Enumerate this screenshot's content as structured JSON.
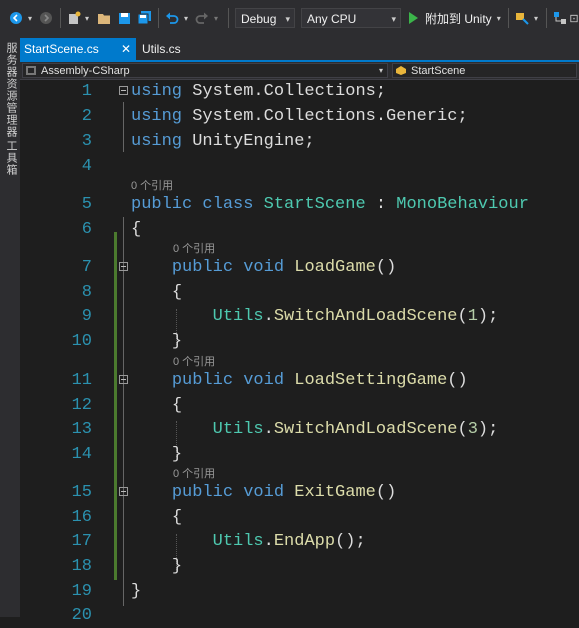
{
  "toolbar": {
    "config_value": "Debug",
    "platform_value": "Any CPU",
    "attach_label": "附加到 Unity"
  },
  "side_tabs": [
    "服务器资源管理器",
    "工具箱"
  ],
  "tabs": [
    {
      "label": "StartScene.cs",
      "active": true,
      "close": "✕"
    },
    {
      "label": "Utils.cs",
      "active": false
    }
  ],
  "nav": {
    "project": "Assembly-CSharp",
    "class": "StartScene"
  },
  "lines": [
    {
      "n": "1"
    },
    {
      "n": "2"
    },
    {
      "n": "3"
    },
    {
      "n": "4"
    },
    {
      "n": "5"
    },
    {
      "n": "6"
    },
    {
      "n": "7"
    },
    {
      "n": "8"
    },
    {
      "n": "9"
    },
    {
      "n": "10"
    },
    {
      "n": "11"
    },
    {
      "n": "12"
    },
    {
      "n": "13"
    },
    {
      "n": "14"
    },
    {
      "n": "15"
    },
    {
      "n": "16"
    },
    {
      "n": "17"
    },
    {
      "n": "18"
    },
    {
      "n": "19"
    },
    {
      "n": "20"
    }
  ],
  "code": {
    "kw_using": "using",
    "ns1": " System.Collections;",
    "ns2": " System.Collections.Generic;",
    "ns3": " UnityEngine;",
    "kw_public": "public",
    "kw_class": "class",
    "kw_void": "void",
    "class_name": "StartScene",
    "colon": " : ",
    "base_class": "MonoBehaviour",
    "brace_open": "{",
    "brace_close": "}",
    "m1": "LoadGame",
    "m2": "LoadSettingGame",
    "m3": "ExitGame",
    "parens": "()",
    "utils": "Utils",
    "dot": ".",
    "switch_fn": "SwitchAndLoadScene",
    "endapp_fn": "EndApp",
    "arg1": "1",
    "arg3": "3",
    "open_paren": "(",
    "close_stmt": ");",
    "empty_call": "();"
  },
  "ref_hint": "0 个引用",
  "colors": {
    "keyword": "#569cd6",
    "type": "#4ec9b0",
    "method": "#dcdcaa",
    "number": "#b5cea8",
    "line_number": "#2b91af",
    "accent": "#007acc"
  }
}
